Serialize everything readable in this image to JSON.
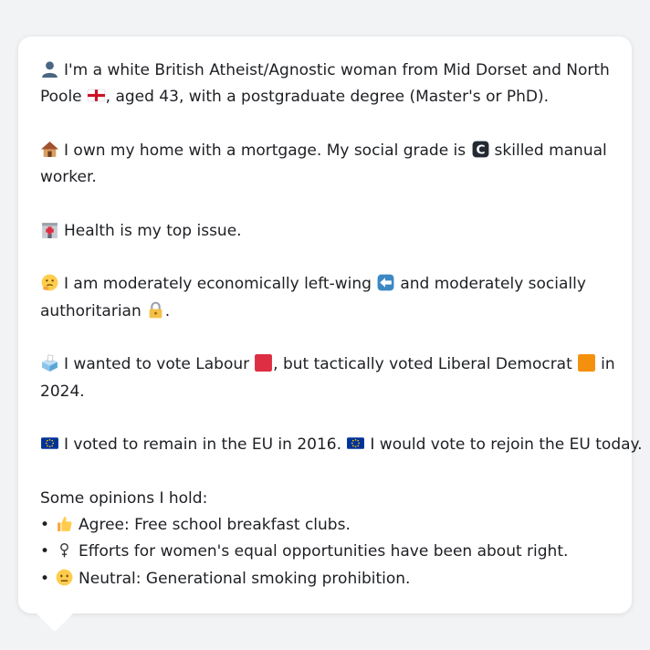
{
  "profile": {
    "identity_line1": "I'm a white British Atheist/Agnostic woman from Mid Dorset and North",
    "identity_line2a": "Poole",
    "identity_line2b": ", aged 43, with a postgraduate degree (Master's or PhD).",
    "home_line1a": "I own my home with a mortgage. My social grade is",
    "home_line1b": "skilled manual",
    "home_line2": "worker.",
    "top_issue": "Health is my top issue.",
    "econ_line1a": "I am moderately economically left-wing",
    "econ_line1b": "and moderately socially",
    "econ_line2": "authoritarian",
    "econ_line2_end": ".",
    "vote_line1a": "I wanted to vote Labour",
    "vote_line1b": ", but tactically voted Liberal Democrat",
    "vote_line1c": "in",
    "vote_line2": "2024.",
    "eu_a": "I voted to remain in the EU in 2016.",
    "eu_b": "I would vote to rejoin the EU today.",
    "opinions_heading": "Some opinions I hold:",
    "opinions": [
      {
        "bullet": "•",
        "text": "Agree: Free school breakfast clubs."
      },
      {
        "bullet": "•",
        "text": "Efforts for women's equal opportunities have been about right."
      },
      {
        "bullet": "•",
        "text": "Neutral: Generational smoking prohibition."
      }
    ]
  },
  "icons": {
    "person": "bust-in-silhouette-icon",
    "england_flag": "england-flag-icon",
    "house": "house-icon",
    "grade_c": "letter-c-icon",
    "hospital": "hospital-icon",
    "thinking": "thinking-face-icon",
    "left_arrow": "left-arrow-icon",
    "lock": "lock-icon",
    "ballot": "ballot-box-icon",
    "labour_square": "red-square-icon",
    "libdem_square": "orange-square-icon",
    "eu_flag": "eu-flag-icon",
    "thumbs_up": "thumbs-up-icon",
    "female_sign": "female-sign-icon",
    "neutral_face": "neutral-face-icon"
  },
  "colors": {
    "labour": "#dd2e44",
    "libdem": "#f4900c",
    "eu_blue": "#003399",
    "eu_star": "#ffcc00"
  }
}
